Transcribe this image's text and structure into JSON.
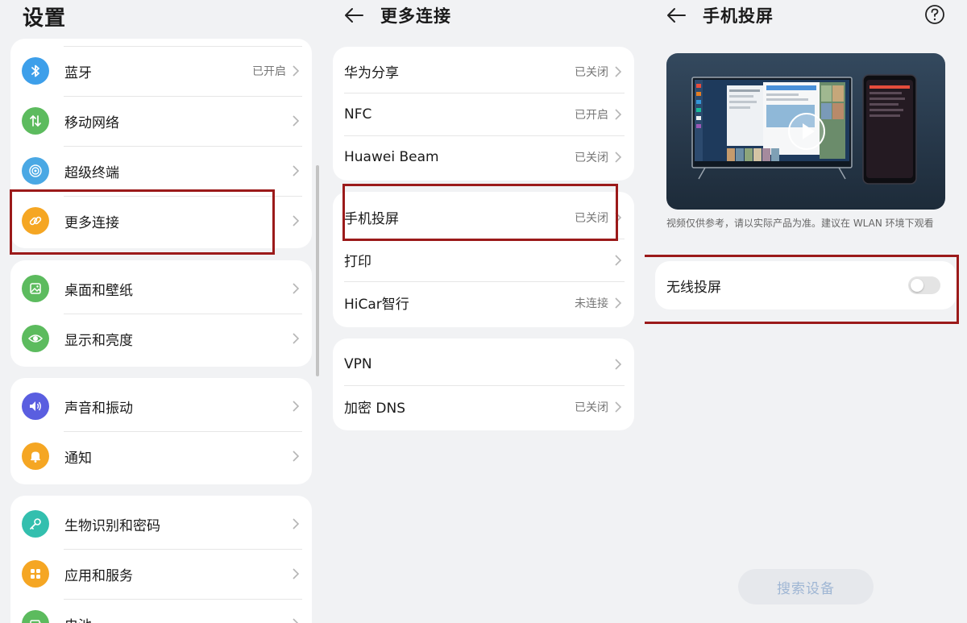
{
  "panel1": {
    "title": "设置",
    "groups": [
      [
        {
          "label": "蓝牙",
          "value": "已开启",
          "icon": "bluetooth-icon",
          "color": "#3d9fea"
        },
        {
          "label": "移动网络",
          "value": "",
          "icon": "mobile-network-icon",
          "color": "#5cbb5e"
        },
        {
          "label": "超级终端",
          "value": "",
          "icon": "super-device-icon",
          "color": "#4aa8e4"
        },
        {
          "label": "更多连接",
          "value": "",
          "icon": "link-icon",
          "color": "#f5a623"
        }
      ],
      [
        {
          "label": "桌面和壁纸",
          "value": "",
          "icon": "wallpaper-icon",
          "color": "#5cbb5e"
        },
        {
          "label": "显示和亮度",
          "value": "",
          "icon": "eye-icon",
          "color": "#5cbb5e"
        }
      ],
      [
        {
          "label": "声音和振动",
          "value": "",
          "icon": "speaker-icon",
          "color": "#5a5ee0"
        },
        {
          "label": "通知",
          "value": "",
          "icon": "bell-icon",
          "color": "#f5a623"
        }
      ],
      [
        {
          "label": "生物识别和密码",
          "value": "",
          "icon": "key-icon",
          "color": "#33bfae"
        },
        {
          "label": "应用和服务",
          "value": "",
          "icon": "apps-icon",
          "color": "#f5a623"
        },
        {
          "label": "电池",
          "value": "",
          "icon": "battery-icon",
          "color": "#5cbb5e"
        }
      ]
    ]
  },
  "panel2": {
    "title": "更多连接",
    "groups": [
      [
        {
          "label": "华为分享",
          "value": "已关闭"
        },
        {
          "label": "NFC",
          "value": "已开启"
        },
        {
          "label": "Huawei Beam",
          "value": "已关闭"
        }
      ],
      [
        {
          "label": "手机投屏",
          "value": "已关闭"
        },
        {
          "label": "打印",
          "value": ""
        },
        {
          "label": "HiCar智行",
          "value": "未连接"
        }
      ],
      [
        {
          "label": "VPN",
          "value": ""
        },
        {
          "label": "加密 DNS",
          "value": "已关闭"
        }
      ]
    ]
  },
  "panel3": {
    "title": "手机投屏",
    "caption": "视频仅供参考，请以实际产品为准。建议在 WLAN 环境下观看",
    "toggle_label": "无线投屏",
    "toggle_on": false,
    "search_button": "搜索设备"
  },
  "colors": {
    "highlight": "#9b1a1a",
    "background": "#f1f2f4",
    "card": "#ffffff"
  }
}
